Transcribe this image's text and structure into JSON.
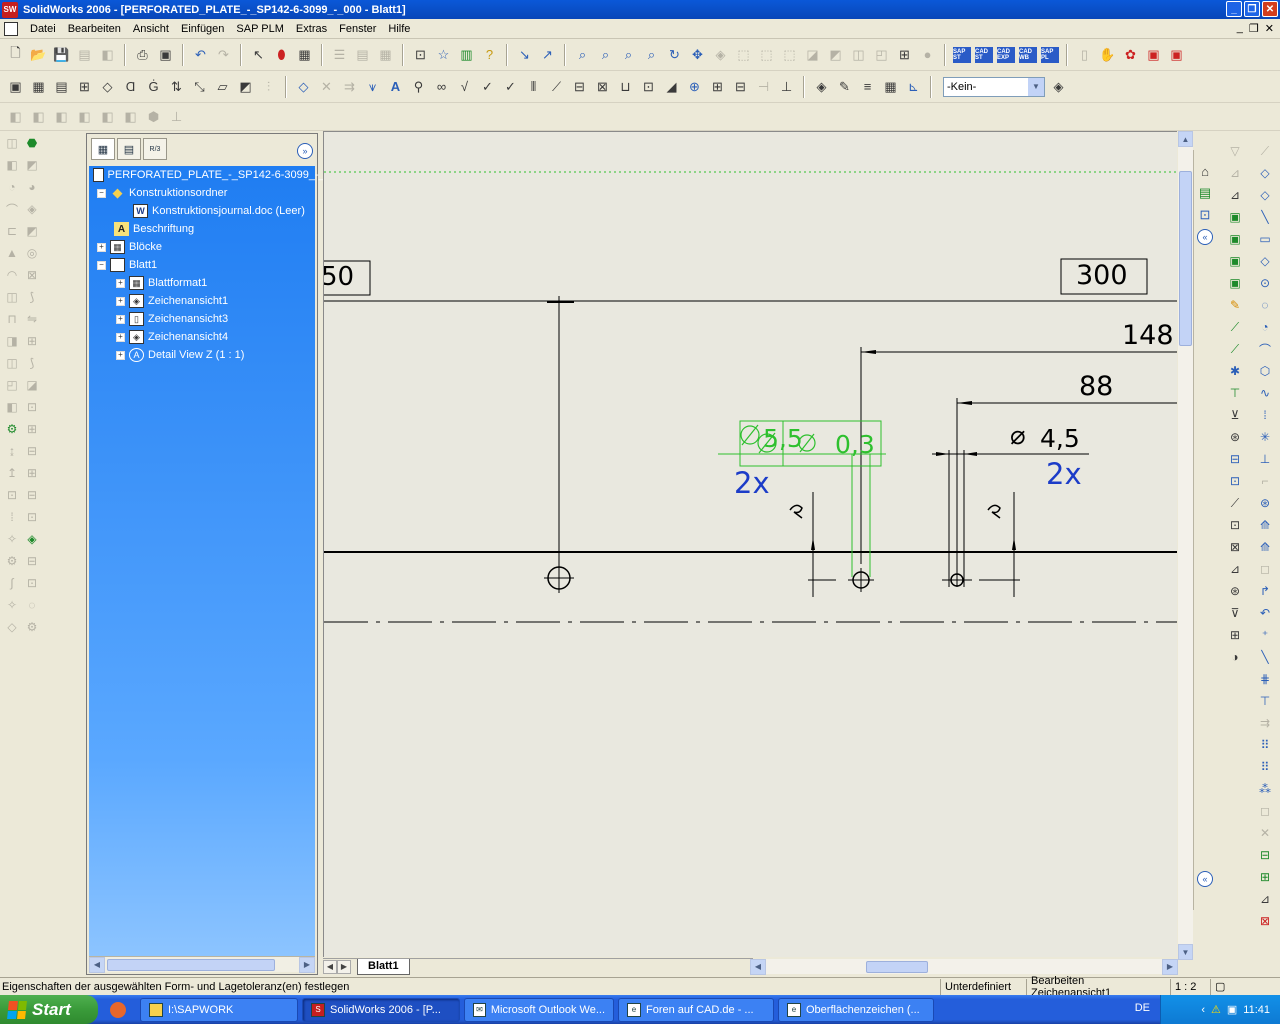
{
  "window": {
    "title": "SolidWorks 2006 - [PERFORATED_PLATE_-_SP142-6-3099_-_000 - Blatt1]",
    "logo": "SW"
  },
  "menu": {
    "items": [
      "Datei",
      "Bearbeiten",
      "Ansicht",
      "Einfügen",
      "SAP PLM",
      "Extras",
      "Fenster",
      "Hilfe"
    ]
  },
  "toolbar": {
    "layer_value": "-Kein-",
    "sap_icons": [
      "SAP ST",
      "CAD ST",
      "CAD EXP",
      "CAD WB",
      "SAP PL"
    ]
  },
  "tree": {
    "tabs": [
      "feature-manager",
      "property-manager",
      "R/3"
    ],
    "tab_r3_label": "R/3",
    "items": [
      {
        "label": "PERFORATED_PLATE_-_SP142-6-3099_-_000",
        "indent": 0,
        "pm": "",
        "icon": "doc"
      },
      {
        "label": "Konstruktionsordner",
        "indent": 1,
        "pm": "-",
        "icon": "folder"
      },
      {
        "label": "Konstruktionsjournal.doc (Leer)",
        "indent": 2,
        "pm": "",
        "icon": "word"
      },
      {
        "label": "Beschriftung",
        "indent": 1,
        "pm": "",
        "icon": "annotation"
      },
      {
        "label": "Blöcke",
        "indent": 1,
        "pm": "+",
        "icon": "blocks"
      },
      {
        "label": "Blatt1",
        "indent": 1,
        "pm": "-",
        "icon": "sheet"
      },
      {
        "label": "Blattformat1",
        "indent": 2,
        "pm": "+",
        "icon": "sheet-format"
      },
      {
        "label": "Zeichenansicht1",
        "indent": 2,
        "pm": "+",
        "icon": "view"
      },
      {
        "label": "Zeichenansicht3",
        "indent": 2,
        "pm": "+",
        "icon": "view"
      },
      {
        "label": "Zeichenansicht4",
        "indent": 2,
        "pm": "+",
        "icon": "view"
      },
      {
        "label": "Detail View Z (1 : 1)",
        "indent": 2,
        "pm": "+",
        "icon": "detail-view"
      }
    ]
  },
  "drawing": {
    "dimensions": {
      "d50": "50",
      "d300": "300",
      "d148": "148",
      "d88": "88",
      "dia45": "4,5",
      "dia55": "5,5",
      "tol": "0,3",
      "qty_left": "2x",
      "qty_right": "2x",
      "diameter_symbol": "⌀"
    },
    "sheet_tab": "Blatt1"
  },
  "status": {
    "message": "Eigenschaften der ausgewählten Form- und Lagetoleranz(en) festlegen",
    "state": "Unterdefiniert",
    "mode": "Bearbeiten Zeichenansicht1",
    "scale": "1 : 2"
  },
  "taskbar": {
    "start_label": "Start",
    "items": [
      {
        "label": "I:\\SAPWORK",
        "icon": "folder"
      },
      {
        "label": "SolidWorks 2006 - [P...",
        "icon": "solidworks",
        "active": true
      },
      {
        "label": "Microsoft Outlook We...",
        "icon": "outlook"
      },
      {
        "label": "Foren auf CAD.de - ...",
        "icon": "ie"
      },
      {
        "label": "Oberflächenzeichen (...",
        "icon": "ie"
      }
    ],
    "language": "DE",
    "clock": "11:41"
  }
}
